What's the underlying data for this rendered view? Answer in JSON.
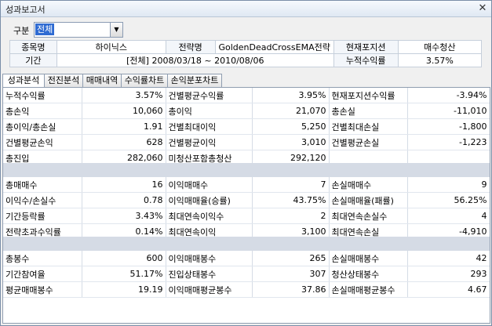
{
  "window": {
    "title": "성과보고서",
    "close_glyph": "✕"
  },
  "filter": {
    "label": "구분",
    "value": "전체",
    "arrow": "▼"
  },
  "info": {
    "item_label": "종목명",
    "item_value": "하이닉스",
    "strategy_label": "전략명",
    "strategy_value": "GoldenDeadCrossEMA전략",
    "position_label": "현재포지션",
    "position_value": "매수청산",
    "period_label": "기간",
    "period_value": "[전체] 2008/03/18 ~ 2010/08/06",
    "cum_label": "누적수익률",
    "cum_value": "3.57%"
  },
  "tabs": [
    "성과분석",
    "전진분석",
    "매매내역",
    "수익률차트",
    "손익분포차트"
  ],
  "section1": [
    [
      "누적수익률",
      "3.57%",
      "건별평균수익률",
      "3.95%",
      "현재포지션수익률",
      "-3.94%"
    ],
    [
      "총손익",
      "10,060",
      "총이익",
      "21,070",
      "총손실",
      "-11,010"
    ],
    [
      "총이익/총손실",
      "1.91",
      "건별최대이익",
      "5,250",
      "건별최대손실",
      "-1,800"
    ],
    [
      "건별평균손익",
      "628",
      "건별평균이익",
      "3,010",
      "건별평균손실",
      "-1,223"
    ],
    [
      "총진입",
      "282,060",
      "미청산포함총청산",
      "292,120",
      "",
      ""
    ]
  ],
  "section2": [
    [
      "총매매수",
      "16",
      "이익매매수",
      "7",
      "손실매매수",
      "9"
    ],
    [
      "이익수/손실수",
      "0.78",
      "이익매매율(승률)",
      "43.75%",
      "손실매매율(패률)",
      "56.25%"
    ],
    [
      "기간등락률",
      "3.43%",
      "최대연속이익수",
      "2",
      "최대연속손실수",
      "4"
    ],
    [
      "전략초과수익률",
      "0.14%",
      "최대연속이익",
      "3,100",
      "최대연속손실",
      "-4,910"
    ]
  ],
  "section3": [
    [
      "총봉수",
      "600",
      "이익매매봉수",
      "265",
      "손실매매봉수",
      "42"
    ],
    [
      "기간참여율",
      "51.17%",
      "진입상태봉수",
      "307",
      "청산상태봉수",
      "293"
    ],
    [
      "평균매매봉수",
      "19.19",
      "이익매매평균봉수",
      "37.86",
      "손실매매평균봉수",
      "4.67"
    ]
  ]
}
